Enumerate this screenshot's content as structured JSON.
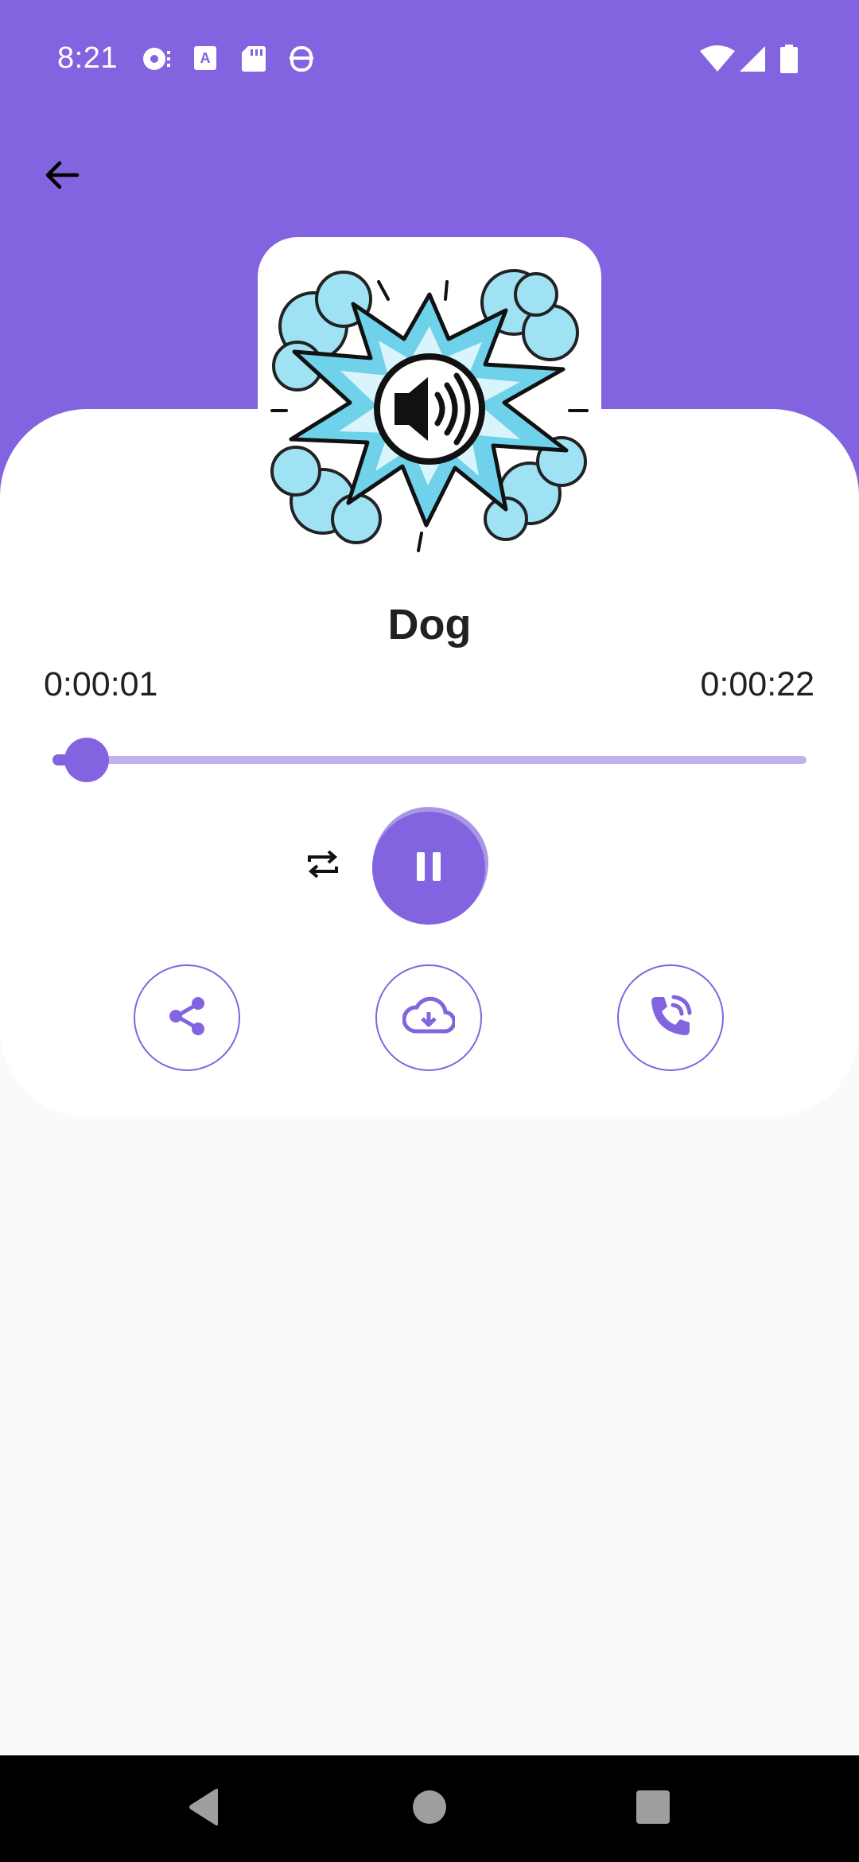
{
  "status_bar": {
    "time": "8:21",
    "left_icons": [
      "podcast-icon",
      "text-icon",
      "sd-card-icon",
      "hanger-icon"
    ],
    "right_icons": [
      "wifi-icon",
      "signal-icon",
      "battery-icon"
    ]
  },
  "header": {
    "back_icon": "arrow-back-icon",
    "background_color": "#8264e0"
  },
  "player": {
    "artwork_icon": "sound-burst-icon",
    "title": "Dog",
    "time_current": "0:00:01",
    "time_total": "0:00:22",
    "progress": 0.045,
    "repeat_icon": "repeat-icon",
    "play_state_icon": "pause-icon",
    "accent_color": "#8264e0"
  },
  "actions": [
    {
      "name": "share",
      "icon": "share-icon"
    },
    {
      "name": "download",
      "icon": "cloud-download-icon"
    },
    {
      "name": "set-ringtone",
      "icon": "phone-ringing-icon"
    }
  ],
  "nav_bar": {
    "icons": [
      "nav-back-icon",
      "nav-home-icon",
      "nav-recents-icon"
    ]
  }
}
